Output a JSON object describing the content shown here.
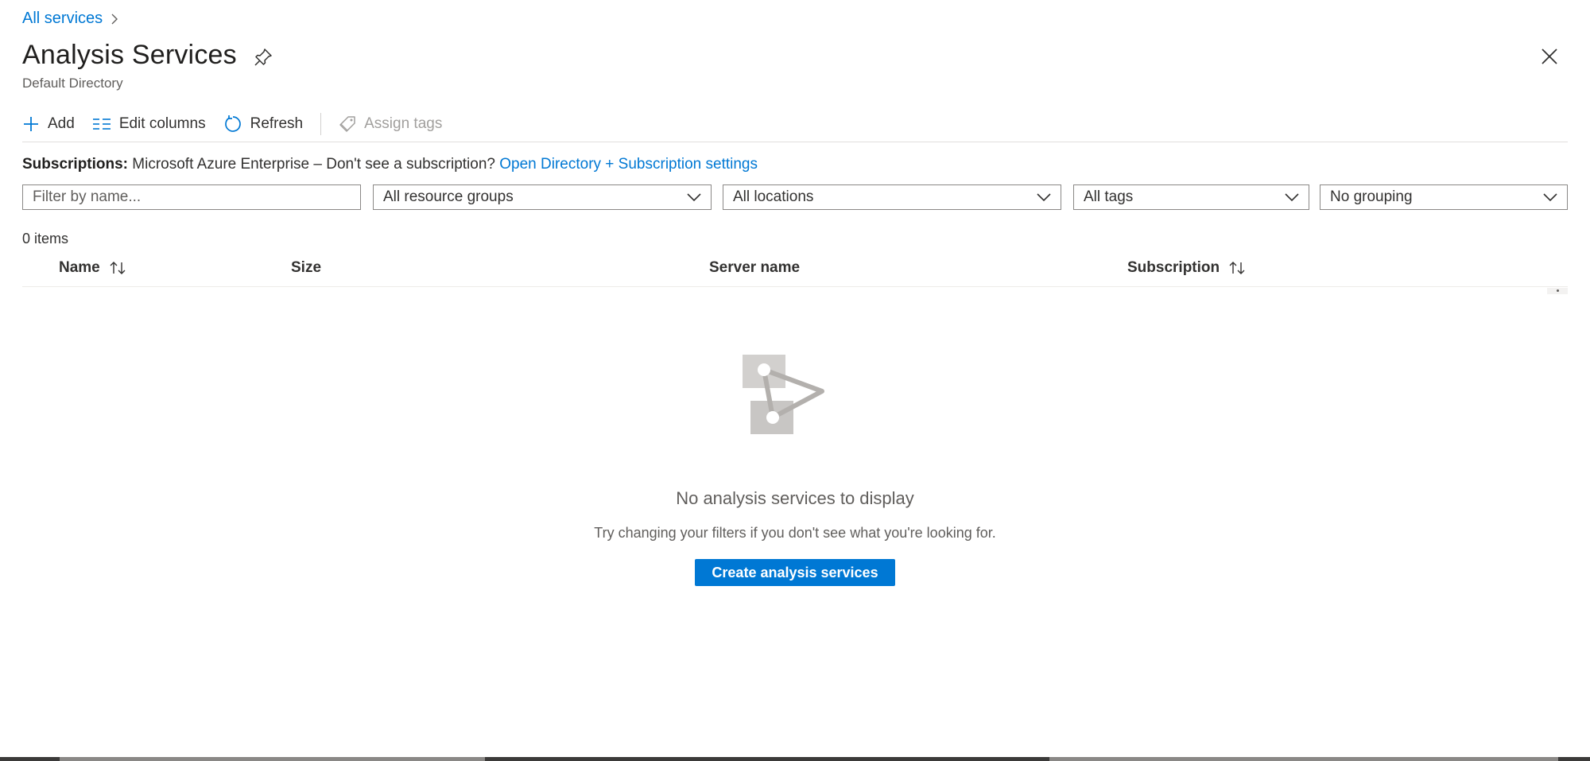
{
  "breadcrumb": {
    "link": "All services"
  },
  "header": {
    "title": "Analysis Services",
    "subtitle": "Default Directory"
  },
  "toolbar": {
    "add_label": "Add",
    "edit_columns_label": "Edit columns",
    "refresh_label": "Refresh",
    "assign_tags_label": "Assign tags"
  },
  "subscriptions": {
    "label": "Subscriptions:",
    "text": "Microsoft Azure Enterprise – Don't see a subscription?",
    "link": "Open Directory + Subscription settings"
  },
  "filters": {
    "name_placeholder": "Filter by name...",
    "resource_groups": "All resource groups",
    "locations": "All locations",
    "tags": "All tags",
    "grouping": "No grouping"
  },
  "table": {
    "count": "0 items",
    "columns": {
      "name": "Name",
      "size": "Size",
      "server_name": "Server name",
      "subscription": "Subscription"
    }
  },
  "empty_state": {
    "title": "No analysis services to display",
    "hint": "Try changing your filters if you don't see what you're looking for.",
    "create_button": "Create analysis services"
  },
  "colors": {
    "accent": "#0078d4",
    "text": "#323130",
    "muted": "#605e5c"
  }
}
